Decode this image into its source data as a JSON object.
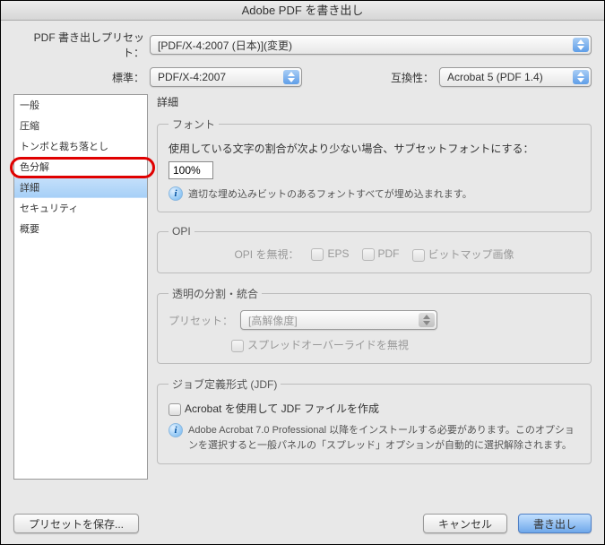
{
  "title": "Adobe PDF を書き出し",
  "preset": {
    "label": "PDF 書き出しプリセット：",
    "value": "[PDF/X-4:2007 (日本)](変更)"
  },
  "standard": {
    "label": "標準：",
    "value": "PDF/X-4:2007"
  },
  "compat": {
    "label": "互換性：",
    "value": "Acrobat 5 (PDF 1.4)"
  },
  "sidebar": {
    "items": [
      {
        "label": "一般"
      },
      {
        "label": "圧縮"
      },
      {
        "label": "トンボと裁ち落とし"
      },
      {
        "label": "色分解"
      },
      {
        "label": "詳細"
      },
      {
        "label": "セキュリティ"
      },
      {
        "label": "概要"
      }
    ]
  },
  "section_title": "詳細",
  "fonts": {
    "legend": "フォント",
    "subset_label": "使用している文字の割合が次より少ない場合、サブセットフォントにする：",
    "subset_value": "100%",
    "info": "適切な埋め込みビットのあるフォントすべてが埋め込まれます。"
  },
  "opi": {
    "legend": "OPI",
    "ignore_label": "OPI を無視：",
    "eps": "EPS",
    "pdf": "PDF",
    "bitmap": "ビットマップ画像"
  },
  "transparency": {
    "legend": "透明の分割・統合",
    "preset_label": "プリセット：",
    "preset_value": "[高解像度]",
    "override_label": "スプレッドオーバーライドを無視"
  },
  "jdf": {
    "legend": "ジョブ定義形式 (JDF)",
    "create_label": "Acrobat を使用して JDF ファイルを作成",
    "info": "Adobe Acrobat 7.0 Professional 以降をインストールする必要があります。このオプションを選択すると一般パネルの「スプレッド」オプションが自動的に選択解除されます。"
  },
  "buttons": {
    "save_preset": "プリセットを保存...",
    "cancel": "キャンセル",
    "export": "書き出し"
  }
}
